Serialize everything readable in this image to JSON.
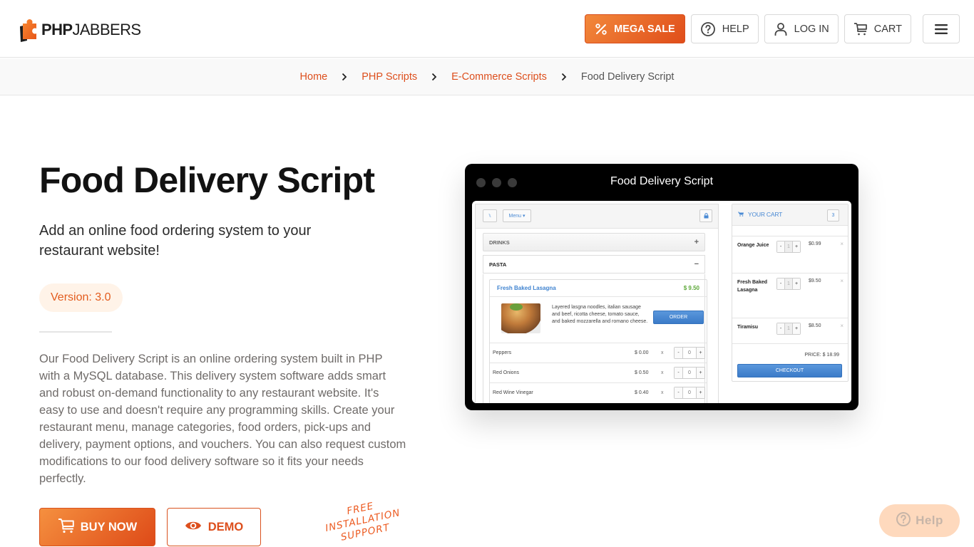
{
  "brand": {
    "name_bold": "PHP",
    "name_light": "JABBERS",
    "accent_color": "#e8561c"
  },
  "nav": {
    "mega_sale": "MEGA SALE",
    "help": "HELP",
    "login": "LOG IN",
    "cart": "CART"
  },
  "breadcrumb": {
    "items": [
      "Home",
      "PHP Scripts",
      "E-Commerce Scripts"
    ],
    "current": "Food Delivery Script"
  },
  "hero": {
    "title": "Food Delivery Script",
    "subtitle": "Add an online food ordering system to your restaurant website!",
    "version": "Version: 3.0",
    "description": "Our Food Delivery Script is an online ordering system built in PHP with a MySQL database. This delivery system software adds smart and robust on-demand functionality to any restaurant website. It's easy to use and doesn't require any programming skills. Create your restaurant menu, manage categories, food orders, pick-ups and delivery, payment options, and vouchers. You can also request custom modifications to our food delivery software so it fits your needs perfectly.",
    "buy_now": "BUY NOW",
    "demo": "DEMO",
    "free_install": [
      "FREE",
      "INSTALLATION",
      "SUPPORT"
    ]
  },
  "preview": {
    "window_title": "Food Delivery Script",
    "menu_button": "Menu ▾",
    "categories": [
      {
        "name": "DRINKS",
        "sign": "+"
      },
      {
        "name": "PASTA",
        "sign": "−"
      }
    ],
    "item": {
      "name": "Fresh Baked Lasagna",
      "price": "$ 9.50",
      "description": "Layered lasgna noodles, italian sausage and beef, ricotta cheese, tomato sauce, and baked mozzarella and romano cheese.",
      "order_label": "ORDER"
    },
    "extras": [
      {
        "name": "Peppers",
        "price": "$ 0.00",
        "x": "x",
        "qty": "0"
      },
      {
        "name": "Red Onions",
        "price": "$ 0.50",
        "x": "x",
        "qty": "0"
      },
      {
        "name": "Red Wine Vinegar",
        "price": "$ 0.40",
        "x": "x",
        "qty": "0"
      }
    ],
    "cart": {
      "title": "YOUR CART",
      "count": "3",
      "items": [
        {
          "name": "Orange Juice",
          "qty": "1",
          "price": "$0.99"
        },
        {
          "name": "Fresh Baked Lasagna",
          "qty": "1",
          "price": "$9.50"
        },
        {
          "name": "Tiramisu",
          "qty": "1",
          "price": "$8.50"
        }
      ],
      "total": "PRICE: $ 18.99",
      "checkout": "CHECKOUT"
    }
  },
  "help_widget": {
    "label": "Help"
  }
}
